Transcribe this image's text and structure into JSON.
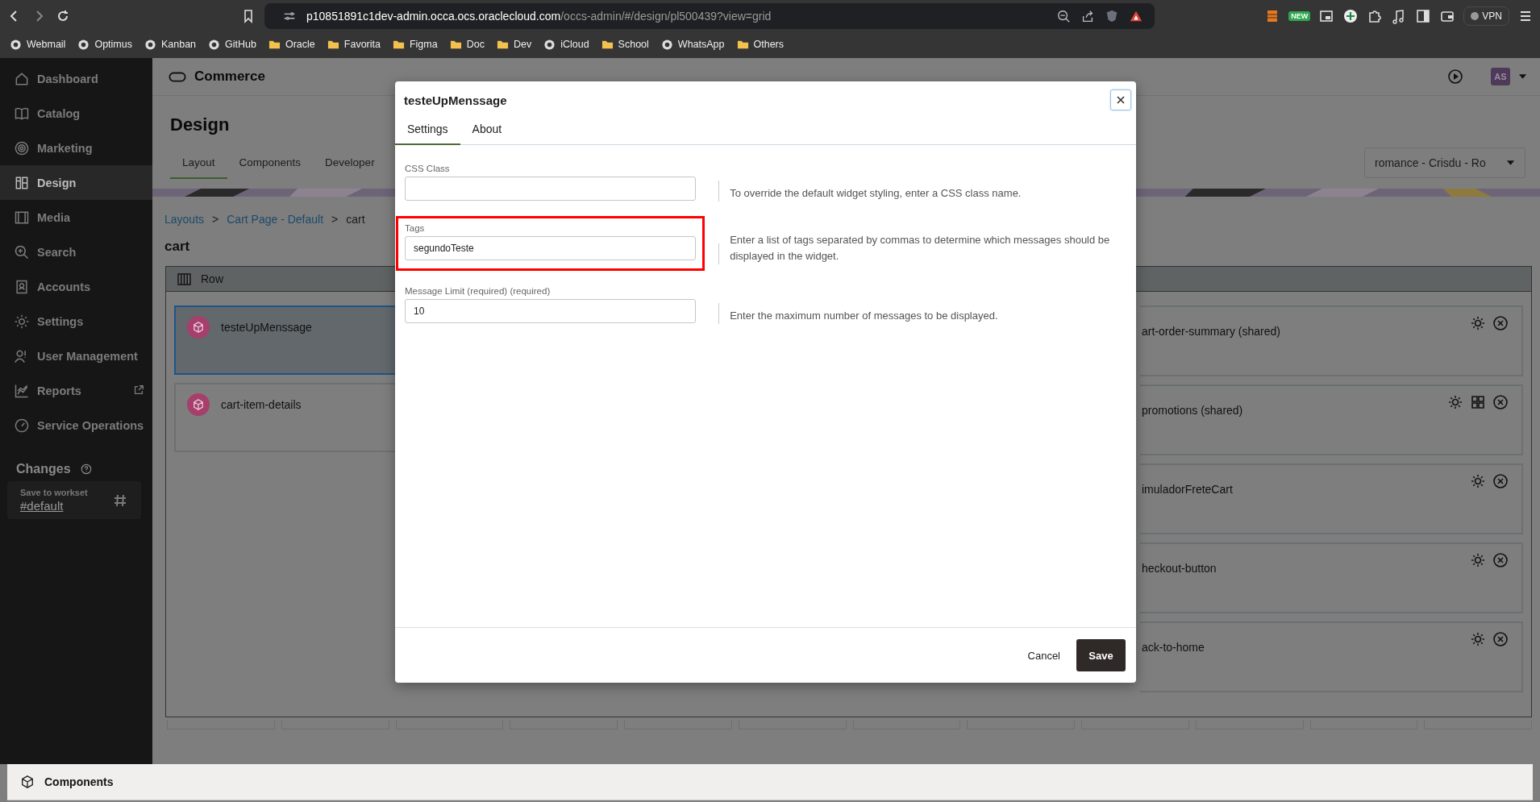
{
  "browser": {
    "url_host": "p10851891c1dev-admin.occa.ocs.oraclecloud.com",
    "url_path": "/occs-admin/#/design/pl500439?view=grid",
    "badge": "NEW",
    "vpn": "VPN",
    "bookmarks": [
      {
        "label": "Webmail",
        "kind": "site"
      },
      {
        "label": "Optimus",
        "kind": "site"
      },
      {
        "label": "Kanban",
        "kind": "site"
      },
      {
        "label": "GitHub",
        "kind": "site"
      },
      {
        "label": "Oracle",
        "kind": "folder"
      },
      {
        "label": "Favorita",
        "kind": "folder"
      },
      {
        "label": "Figma",
        "kind": "folder"
      },
      {
        "label": "Doc",
        "kind": "folder"
      },
      {
        "label": "Dev",
        "kind": "folder"
      },
      {
        "label": "iCloud",
        "kind": "site"
      },
      {
        "label": "School",
        "kind": "folder"
      },
      {
        "label": "WhatsApp",
        "kind": "site"
      },
      {
        "label": "Others",
        "kind": "folder"
      }
    ]
  },
  "sidebar": {
    "items": [
      {
        "label": "Dashboard",
        "selected": false,
        "external": false
      },
      {
        "label": "Catalog",
        "selected": false,
        "external": false
      },
      {
        "label": "Marketing",
        "selected": false,
        "external": false
      },
      {
        "label": "Design",
        "selected": true,
        "external": false
      },
      {
        "label": "Media",
        "selected": false,
        "external": false
      },
      {
        "label": "Search",
        "selected": false,
        "external": false
      },
      {
        "label": "Accounts",
        "selected": false,
        "external": false
      },
      {
        "label": "Settings",
        "selected": false,
        "external": false
      },
      {
        "label": "User Management",
        "selected": false,
        "external": false
      },
      {
        "label": "Reports",
        "selected": false,
        "external": true
      },
      {
        "label": "Service Operations",
        "selected": false,
        "external": false
      }
    ],
    "changes_title": "Changes",
    "workset_label": "Save to workset",
    "workset": "#default"
  },
  "header": {
    "title": "Commerce",
    "avatar": "AS"
  },
  "page": {
    "title": "Design",
    "tabs": [
      {
        "label": "Layout",
        "selected": true
      },
      {
        "label": "Components",
        "selected": false
      },
      {
        "label": "Developer",
        "selected": false
      }
    ],
    "site_select": "romance - Crisdu - Ro",
    "breadcrumb": [
      "Layouts",
      "Cart Page - Default",
      "cart"
    ],
    "breadcrumb_separators": [
      ">",
      ">"
    ],
    "layout_title": "cart",
    "row_label": "Row",
    "left_cards": [
      {
        "name": "testeUpMenssage",
        "selected": true
      },
      {
        "name": "cart-item-details",
        "selected": false
      }
    ],
    "right_cards": [
      {
        "name": "art-order-summary (shared)",
        "grid": false
      },
      {
        "name": "promotions (shared)",
        "grid": true
      },
      {
        "name": "imuladorFreteCart",
        "grid": false
      },
      {
        "name": "heckout-button",
        "grid": false
      },
      {
        "name": "ack-to-home",
        "grid": false
      }
    ]
  },
  "modal": {
    "title": "testeUpMenssage",
    "tabs": [
      {
        "label": "Settings",
        "selected": true
      },
      {
        "label": "About",
        "selected": false
      }
    ],
    "fields": [
      {
        "label": "CSS Class",
        "help": "To override the default widget styling, enter a CSS class name.",
        "highlighted": false
      },
      {
        "label": "Tags",
        "value": "segundoTeste",
        "help": "Enter a list of tags separated by commas to determine which messages should be displayed in the widget.",
        "highlighted": true
      },
      {
        "label": "Message Limit (required) (required)",
        "value": "10",
        "help": "Enter the maximum number of messages to be displayed.",
        "highlighted": false
      }
    ],
    "cancel": "Cancel",
    "save": "Save"
  },
  "bottom_bar": "Components"
}
